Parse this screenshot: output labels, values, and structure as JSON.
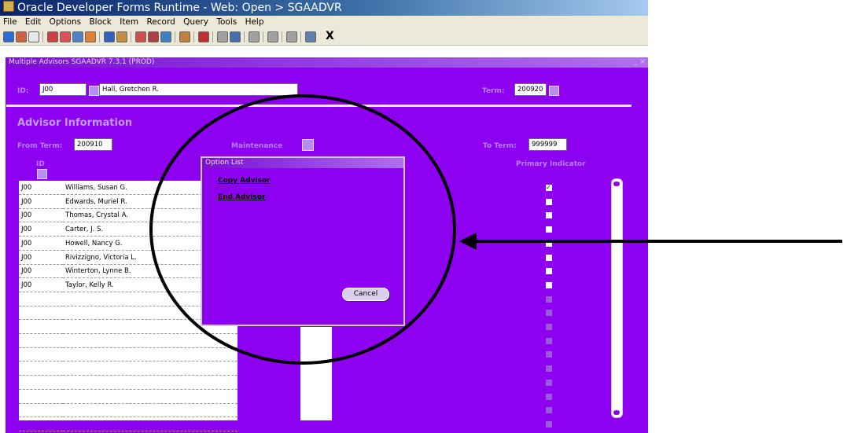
{
  "window": {
    "title": "Oracle Developer Forms Runtime - Web:  Open > SGAADVR"
  },
  "menu": [
    "File",
    "Edit",
    "Options",
    "Block",
    "Item",
    "Record",
    "Query",
    "Tools",
    "Help"
  ],
  "toolbar": {
    "exit_label": "X",
    "colors": [
      "#2a6ad8",
      "#d06040",
      "#e8e8e8",
      "#d04040",
      "#e05050",
      "#5080c8",
      "#e08030",
      "#3060c0",
      "#c09040",
      "#d05050",
      "#b04040",
      "#4080c0",
      "#c08040",
      "#c03030",
      "#a0a0a0",
      "#4070b0",
      "#a0a0a0",
      "#a0a0a0",
      "#a0a0a0",
      "#6080b0"
    ]
  },
  "form": {
    "title": "Multiple Advisors  SGAADVR  7.3.1  (PROD)",
    "window_controls": "_ ×",
    "id_label": "ID:",
    "id_value": "J00",
    "name_value": "Hall, Gretchen R.",
    "term_label": "Term:",
    "term_value": "200920"
  },
  "advisor": {
    "heading": "Advisor Information",
    "from_term_label": "From Term:",
    "from_term_value": "200910",
    "maintenance_label": "Maintenance",
    "to_term_label": "To Term:",
    "to_term_value": "999999",
    "id_col_label": "ID",
    "primary_label": "Primary Indicator",
    "rows": [
      {
        "id": "J00",
        "name": "Williams, Susan G.",
        "primary": true
      },
      {
        "id": "J00",
        "name": "Edwards, Muriel R.",
        "primary": false
      },
      {
        "id": "J00",
        "name": "Thomas, Crystal A.",
        "primary": false
      },
      {
        "id": "J00",
        "name": "Carter, J. S.",
        "primary": false
      },
      {
        "id": "J00",
        "name": "Howell, Nancy G.",
        "primary": false
      },
      {
        "id": "J00",
        "name": "Rivizzigno, Victoria L.",
        "primary": false
      },
      {
        "id": "J00",
        "name": "Winterton, Lynne B.",
        "primary": false
      },
      {
        "id": "J00",
        "name": "Taylor, Kelly R.",
        "primary": false
      },
      {
        "id": "",
        "name": "",
        "primary": null
      },
      {
        "id": "",
        "name": "",
        "primary": null
      },
      {
        "id": "",
        "name": "",
        "primary": null
      },
      {
        "id": "",
        "name": "",
        "primary": null
      },
      {
        "id": "",
        "name": "",
        "primary": null
      },
      {
        "id": "",
        "name": "",
        "primary": null
      },
      {
        "id": "",
        "name": "",
        "primary": null
      },
      {
        "id": "",
        "name": "",
        "primary": null
      },
      {
        "id": "",
        "name": "",
        "primary": null
      },
      {
        "id": "",
        "name": "",
        "primary": null
      }
    ]
  },
  "option_list": {
    "title": "Option List",
    "items": [
      "Copy Advisor",
      "End Advisor"
    ],
    "cancel_label": "Cancel"
  },
  "colors": {
    "form_bg": "#8d00f0",
    "label": "#b780ff"
  }
}
